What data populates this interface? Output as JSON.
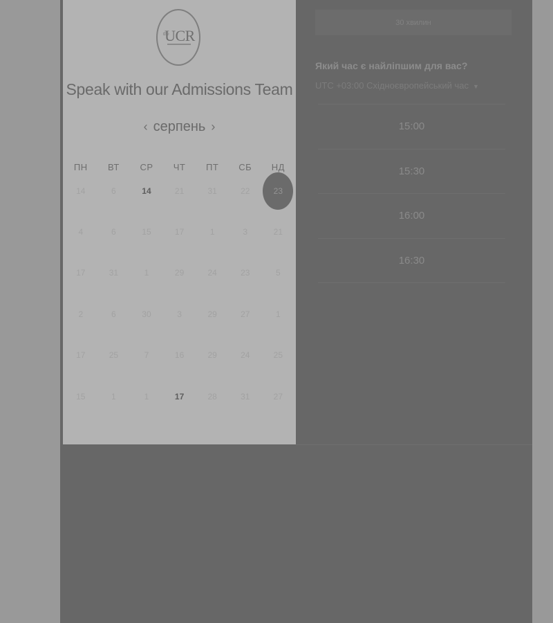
{
  "logo": {
    "text": "UCR",
    "sup": "the"
  },
  "header": {
    "title": "Speak with our Admissions Team"
  },
  "calendar": {
    "month": "серпень",
    "weekdays": [
      "ПН",
      "ВТ",
      "СР",
      "ЧТ",
      "ПТ",
      "СБ",
      "НД"
    ],
    "weeks": [
      [
        "14",
        "6",
        "14",
        "21",
        "31",
        "22",
        "23"
      ],
      [
        "4",
        "6",
        "15",
        "17",
        "1",
        "3",
        "21"
      ],
      [
        "17",
        "31",
        "1",
        "29",
        "24",
        "23",
        "5"
      ],
      [
        "2",
        "6",
        "30",
        "3",
        "29",
        "27",
        "1"
      ],
      [
        "17",
        "25",
        "7",
        "16",
        "29",
        "24",
        "25"
      ],
      [
        "15",
        "1",
        "1",
        "17",
        "28",
        "31",
        "27"
      ]
    ],
    "bold_days": [
      "0-2",
      "5-3"
    ],
    "selected_day": "0-6"
  },
  "booking": {
    "duration": "30 хвилин",
    "question": "Який час є найліпшим для вас?",
    "timezone": "UTC +03:00 Східноєвропейський час",
    "slots": [
      "15:00",
      "15:30",
      "16:00",
      "16:30"
    ]
  }
}
